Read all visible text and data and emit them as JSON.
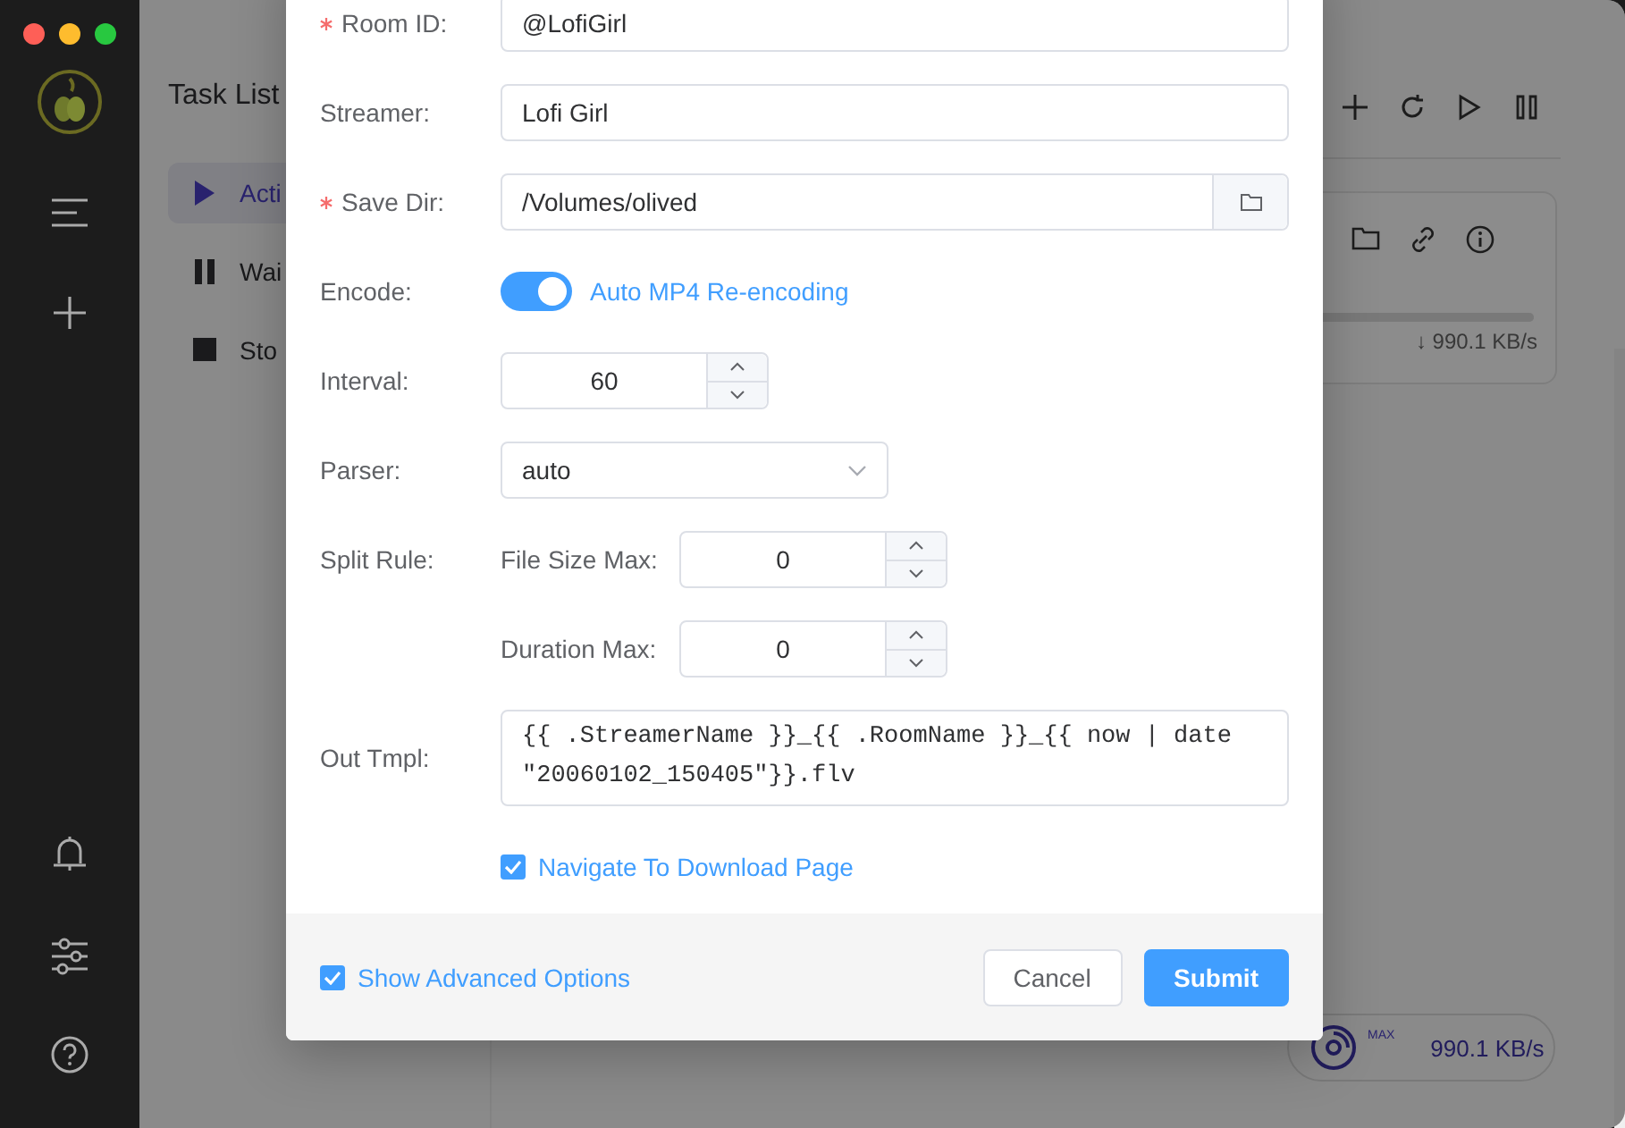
{
  "task_list": {
    "title": "Task List",
    "nav": [
      {
        "label": "Acti",
        "kind": "active",
        "selected": true
      },
      {
        "label": "Wai",
        "kind": "waiting",
        "selected": false
      },
      {
        "label": "Sto",
        "kind": "stopped",
        "selected": false
      }
    ],
    "task_card": {
      "level": 1,
      "speed": "↓ 990.1 KB/s"
    },
    "speed_badge": {
      "tag": "MAX",
      "speed": "990.1 KB/s"
    }
  },
  "dialog": {
    "fields": [
      {
        "kind": "text",
        "label": "Room ID:",
        "required": true,
        "value": "@LofiGirl"
      },
      {
        "kind": "text",
        "label": "Streamer:",
        "required": false,
        "value": "Lofi Girl"
      },
      {
        "kind": "dir",
        "label": "Save Dir:",
        "required": true,
        "value": "/Volumes/olived"
      },
      {
        "kind": "switch",
        "label": "Encode:",
        "required": false,
        "on": true,
        "text": "Auto MP4 Re-encoding"
      },
      {
        "kind": "number",
        "label": "Interval:",
        "required": false,
        "value": "60"
      },
      {
        "kind": "select",
        "label": "Parser:",
        "required": false,
        "value": "auto"
      },
      {
        "kind": "split",
        "label": "Split Rule:",
        "required": false,
        "sublabel": "File Size Max:",
        "value": "0"
      },
      {
        "kind": "split",
        "sublabel": "Duration Max:",
        "value": "0"
      },
      {
        "kind": "textarea",
        "label": "Out Tmpl:",
        "required": false,
        "value": "{{ .StreamerName }}_{{ .RoomName }}_{{ now | date \"20060102_150405\"}}.flv"
      },
      {
        "kind": "checkbox",
        "text": "Navigate To Download Page",
        "checked": true
      }
    ],
    "footer": {
      "advanced": {
        "text": "Show Advanced Options",
        "checked": true
      },
      "buttons": [
        {
          "label": "Cancel",
          "kind": "default"
        },
        {
          "label": "Submit",
          "kind": "primary"
        }
      ]
    }
  }
}
